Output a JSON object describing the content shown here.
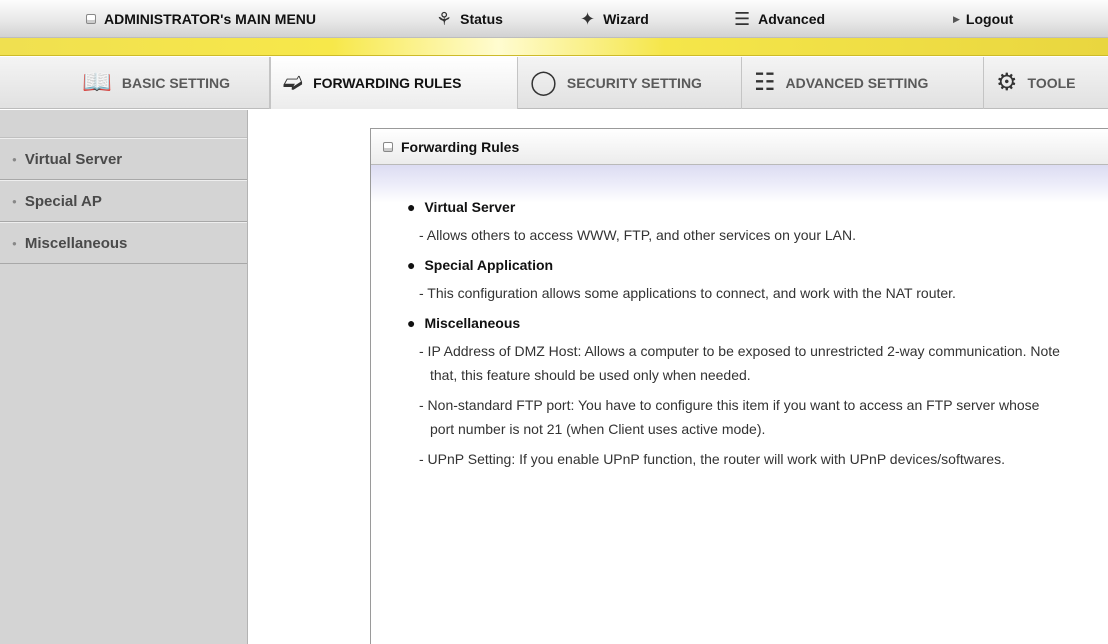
{
  "topmenu": {
    "admin_label": "ADMINISTRATOR's MAIN MENU",
    "status_label": "Status",
    "wizard_label": "Wizard",
    "advanced_label": "Advanced",
    "logout_label": "Logout"
  },
  "tabs": [
    {
      "label": "BASIC SETTING",
      "icon": "book-icon"
    },
    {
      "label": "FORWARDING RULES",
      "icon": "forwarding-icon",
      "active": true
    },
    {
      "label": "SECURITY SETTING",
      "icon": "lock-icon"
    },
    {
      "label": "ADVANCED SETTING",
      "icon": "advanced-icon"
    },
    {
      "label": "TOOLE",
      "icon": "toolbox-icon"
    }
  ],
  "sidebar": {
    "items": [
      {
        "label": "Virtual Server"
      },
      {
        "label": "Special AP"
      },
      {
        "label": "Miscellaneous"
      }
    ]
  },
  "panel": {
    "title": "Forwarding Rules",
    "sections": [
      {
        "title": "Virtual Server",
        "lines": [
          "- Allows others to access WWW, FTP, and other services on your LAN."
        ]
      },
      {
        "title": "Special Application",
        "lines": [
          "- This configuration allows some applications to connect, and work with the NAT router."
        ]
      },
      {
        "title": "Miscellaneous",
        "lines": [
          "- IP Address of DMZ Host: Allows a computer to be exposed to unrestricted 2-way communication. Note that, this feature should be used only when needed.",
          "- Non-standard FTP port: You have to configure this item if you want to access an FTP server whose port number is not 21 (when Client uses active mode).",
          "- UPnP Setting: If you enable UPnP function, the router will work with UPnP devices/softwares."
        ]
      }
    ]
  },
  "colors": {
    "accent_yellow": "#f7e84a",
    "sidebar_bg": "#d4d4d4",
    "panel_sub_lavender": "#dcdcf2"
  }
}
